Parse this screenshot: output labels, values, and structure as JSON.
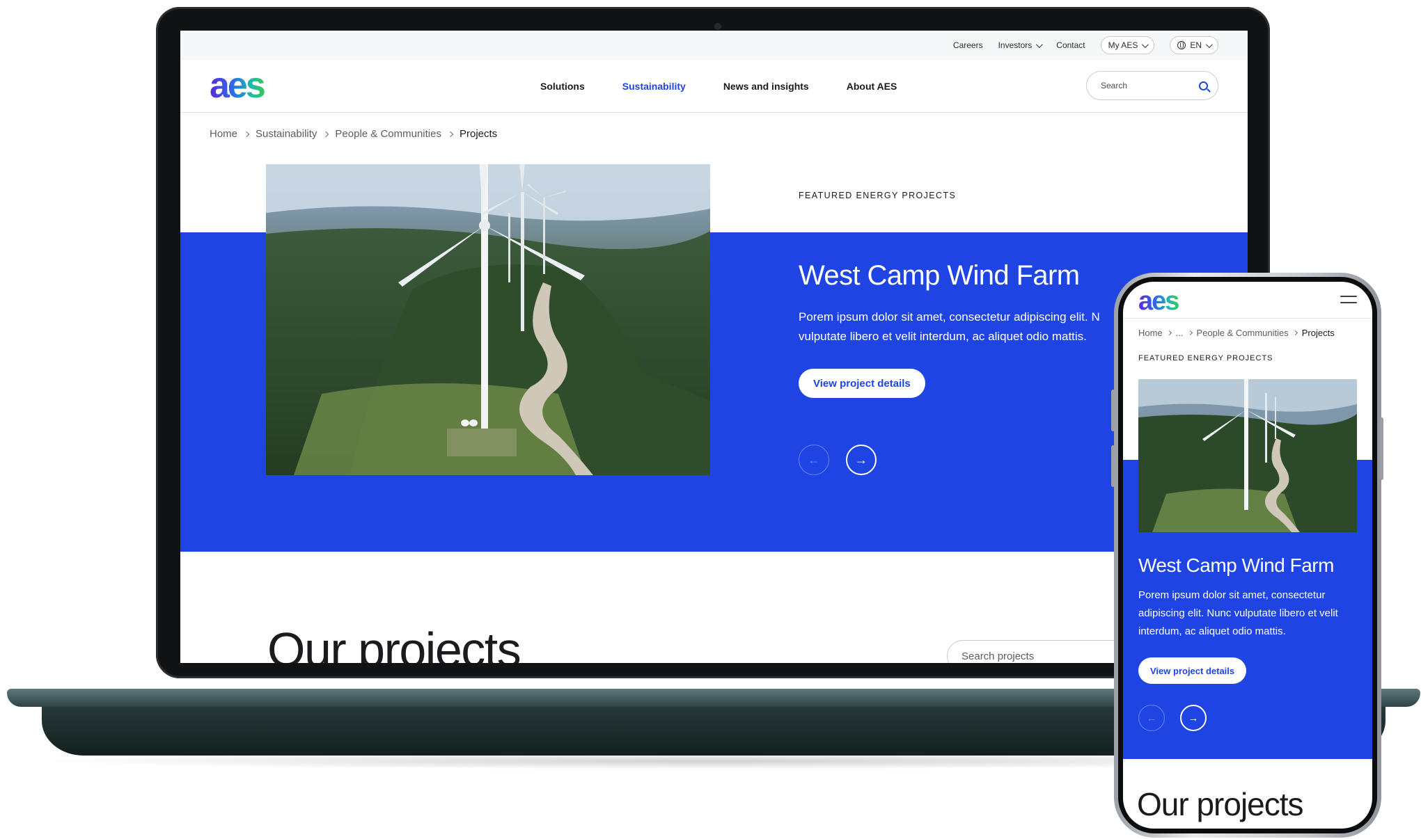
{
  "brand": {
    "logo_text": "aes",
    "accent_blue": "#1e45e3",
    "logo_gradient": [
      "#5b2bd9",
      "#2a6fe8",
      "#1fb9a9",
      "#38c95a"
    ]
  },
  "desktop": {
    "utility_nav": {
      "careers": "Careers",
      "investors": "Investors",
      "contact": "Contact",
      "my_aes": "My AES",
      "language": "EN"
    },
    "main_nav": {
      "items": [
        "Solutions",
        "Sustainability",
        "News and insights",
        "About AES"
      ],
      "active": "Sustainability"
    },
    "search": {
      "placeholder": "Search"
    },
    "breadcrumb": [
      "Home",
      "Sustainability",
      "People & Communities",
      "Projects"
    ],
    "hero": {
      "eyebrow": "FEATURED ENERGY PROJECTS",
      "title": "West Camp Wind Farm",
      "description": "Porem ipsum dolor sit amet, consectetur adipiscing elit. N vulputate libero et velit interdum, ac aliquet odio mattis.",
      "cta": "View project details",
      "prev_arrow": "←",
      "next_arrow": "→"
    },
    "projects": {
      "heading": "Our projects",
      "search_placeholder": "Search projects"
    }
  },
  "mobile": {
    "breadcrumb": [
      "Home",
      "...",
      "People & Communities",
      "Projects"
    ],
    "hero": {
      "eyebrow": "FEATURED ENERGY PROJECTS",
      "title": "West Camp Wind Farm",
      "description": "Porem ipsum dolor sit amet, consectetur adipiscing elit. Nunc vulputate libero et velit interdum, ac aliquet odio mattis.",
      "cta": "View project details",
      "prev_arrow": "←",
      "next_arrow": "→"
    },
    "projects": {
      "heading": "Our projects"
    }
  }
}
